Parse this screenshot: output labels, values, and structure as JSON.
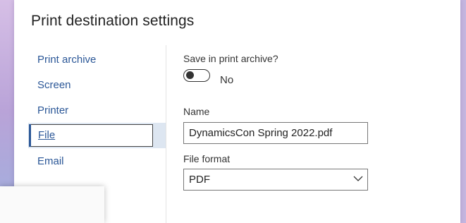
{
  "dialog": {
    "title": "Print destination settings"
  },
  "nav": {
    "items": [
      {
        "label": "Print archive",
        "selected": false
      },
      {
        "label": "Screen",
        "selected": false
      },
      {
        "label": "Printer",
        "selected": false
      },
      {
        "label": "File",
        "selected": true
      },
      {
        "label": "Email",
        "selected": false
      }
    ]
  },
  "form": {
    "save_archive_label": "Save in print archive?",
    "save_archive_toggle_text": "No",
    "name_label": "Name",
    "name_value": "DynamicsCon Spring 2022.pdf",
    "format_label": "File format",
    "format_value": "PDF"
  },
  "colors": {
    "link": "#2b5797",
    "selected_bg": "#dde6f1"
  },
  "icons": {
    "toggle": "toggle-off-icon",
    "dropdown": "chevron-down-icon"
  }
}
